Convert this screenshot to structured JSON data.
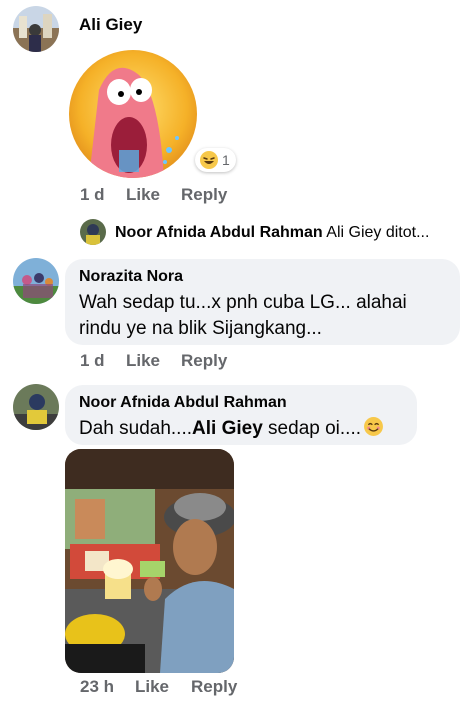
{
  "comment1": {
    "author": "Ali Giey",
    "reaction_count": "1",
    "time": "1 d",
    "like_label": "Like",
    "reply_label": "Reply"
  },
  "reply_preview": {
    "author": "Noor Afnida Abdul Rahman",
    "snippet": "Ali Giey ditot..."
  },
  "comment2": {
    "author": "Norazita Nora",
    "text_line1": "Wah sedap tu...x pnh cuba LG... alahai",
    "text_line2": "rindu ye na blik Sijangkang...",
    "time": "1 d",
    "like_label": "Like",
    "reply_label": "Reply"
  },
  "comment3": {
    "author": "Noor Afnida Abdul Rahman",
    "text_prefix": "Dah sudah....",
    "mention": "Ali Giey",
    "text_suffix": " sedap oi....",
    "time": "23 h",
    "like_label": "Like",
    "reply_label": "Reply"
  },
  "colors": {
    "bubble": "#f0f2f5",
    "meta": "#65676b",
    "text": "#050505"
  }
}
